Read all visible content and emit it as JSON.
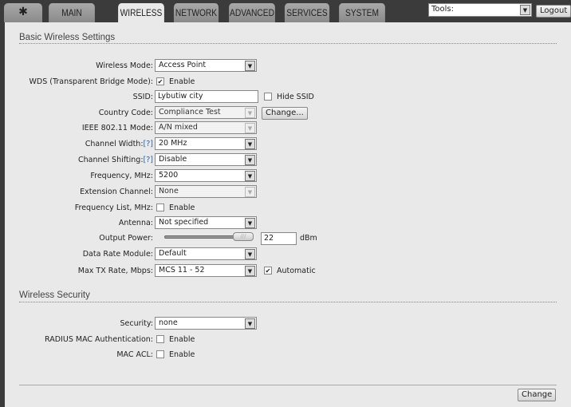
{
  "nav": {
    "tabs": [
      "MAIN",
      "WIRELESS",
      "NETWORK",
      "ADVANCED",
      "SERVICES",
      "SYSTEM"
    ],
    "active": "WIRELESS",
    "tools_label": "Tools:",
    "logout": "Logout"
  },
  "basic": {
    "heading": "Basic Wireless Settings",
    "wireless_mode": {
      "label": "Wireless Mode:",
      "value": "Access Point"
    },
    "wds": {
      "label": "WDS (Transparent Bridge Mode):",
      "checkbox": "Enable",
      "checked": true
    },
    "ssid": {
      "label": "SSID:",
      "value": "Lybutiw city",
      "hide": "Hide SSID"
    },
    "country": {
      "label": "Country Code:",
      "value": "Compliance Test",
      "button": "Change..."
    },
    "ieee": {
      "label": "IEEE 802.11 Mode:",
      "value": "A/N mixed"
    },
    "channel_width": {
      "label": "Channel Width:",
      "help": "[?]",
      "value": "20 MHz"
    },
    "channel_shifting": {
      "label": "Channel Shifting:",
      "help": "[?]",
      "value": "Disable"
    },
    "frequency": {
      "label": "Frequency, MHz:",
      "value": "5200"
    },
    "extension": {
      "label": "Extension Channel:",
      "value": "None"
    },
    "freq_list": {
      "label": "Frequency List, MHz:",
      "checkbox": "Enable"
    },
    "antenna": {
      "label": "Antenna:",
      "value": "Not specified"
    },
    "output_power": {
      "label": "Output Power:",
      "value": "22",
      "unit": "dBm",
      "slider_fraction": 1.0
    },
    "data_rate": {
      "label": "Data Rate Module:",
      "value": "Default"
    },
    "max_tx": {
      "label": "Max TX Rate, Mbps:",
      "value": "MCS 11 - 52",
      "auto": "Automatic"
    }
  },
  "security": {
    "heading": "Wireless Security",
    "security": {
      "label": "Security:",
      "value": "none"
    },
    "radius": {
      "label": "RADIUS MAC Authentication:",
      "checkbox": "Enable"
    },
    "macacl": {
      "label": "MAC ACL:",
      "checkbox": "Enable"
    }
  },
  "change": "Change"
}
